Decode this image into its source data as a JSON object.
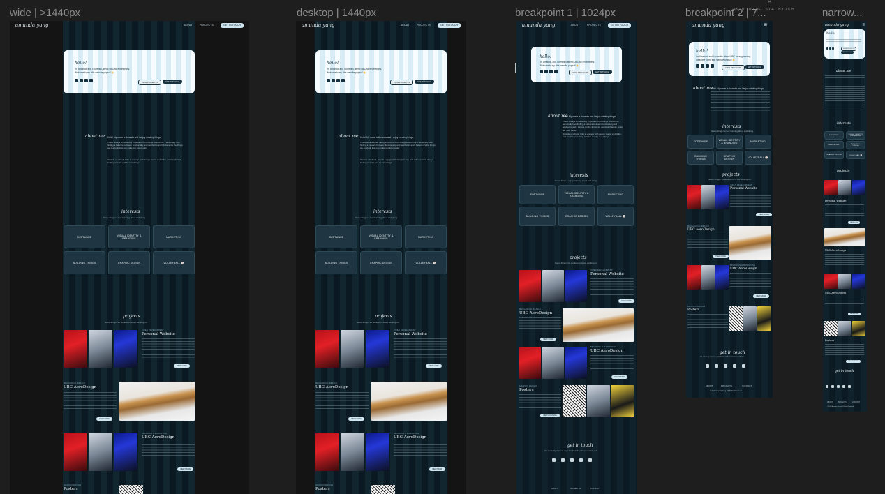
{
  "canvas": {
    "frames": [
      {
        "label": "wide | >1440px"
      },
      {
        "label": "desktop | 1440px"
      },
      {
        "label": "breakpoint 1 | 1024px"
      },
      {
        "label": "breakpoint 2 | 7..."
      },
      {
        "label": "narrow..."
      }
    ],
    "top_tiny": [
      "H...",
      "ABOUT",
      "PROJECTS",
      "GET IN TOUCH"
    ]
  },
  "site": {
    "logo": "amanda yang",
    "nav": {
      "about": "ABOUT",
      "projects": "PROJECTS",
      "cta": "GET IN TOUCH"
    },
    "hero": {
      "hello": "hello!",
      "line1": "I'm Amanda, and I currently attend UBC for engineering.",
      "line2": "Welcome to my little website project! 👋",
      "btn_projects": "VIEW PROJECTS",
      "btn_touch": "GET IN TOUCH"
    },
    "about": {
      "title": "about me",
      "lead": "Hello! My name is Amanda and I enjoy creating things.",
      "p1": "I have always loved taking inspiration from things around me. I personally love finding a balance between functionality and aesthetics and I believe it's the things we overlook that can make our lives better.",
      "p2": "Outside of school, I like to engage with design teams and clubs, and I'm always looking to learn and try new things."
    },
    "interests": {
      "title": "interests",
      "sub": "Some things I enjoy learning about and doing",
      "tiles": [
        "SOFTWARE",
        "VISUAL IDENTITY & BRANDING",
        "MARKETING",
        "BUILDING THINGS",
        "GRAPHIC DESIGN",
        "VOLLEYBALL 🏐"
      ]
    },
    "projects": {
      "title": "projects",
      "sub": "Some things I've worked on or am working on",
      "items": [
        {
          "tag": "VIDEO DEVELOPMENT",
          "title": "Personal Website",
          "btn": "VIEW CODE"
        },
        {
          "tag": "MECHANICAL DESIGN",
          "title": "UBC AeroDesign",
          "btn": "VIEW CODE"
        },
        {
          "tag": "BRANDING & MARKETING",
          "title": "UBC AeroDesign",
          "btn": "VIEW MORE"
        },
        {
          "tag": "GRAPHIC DESIGN",
          "title": "Posters",
          "btn": "VIEW POSTERS"
        }
      ]
    },
    "contact": {
      "title": "get in touch",
      "sub": "I'm currently open to opportunities! Feel free to reach out."
    },
    "footer": {
      "about": "ABOUT",
      "projects": "PROJECTS",
      "contact": "CONTACT",
      "copyright": "© 2024 Amanda Yang. All Rights Reserved."
    }
  }
}
